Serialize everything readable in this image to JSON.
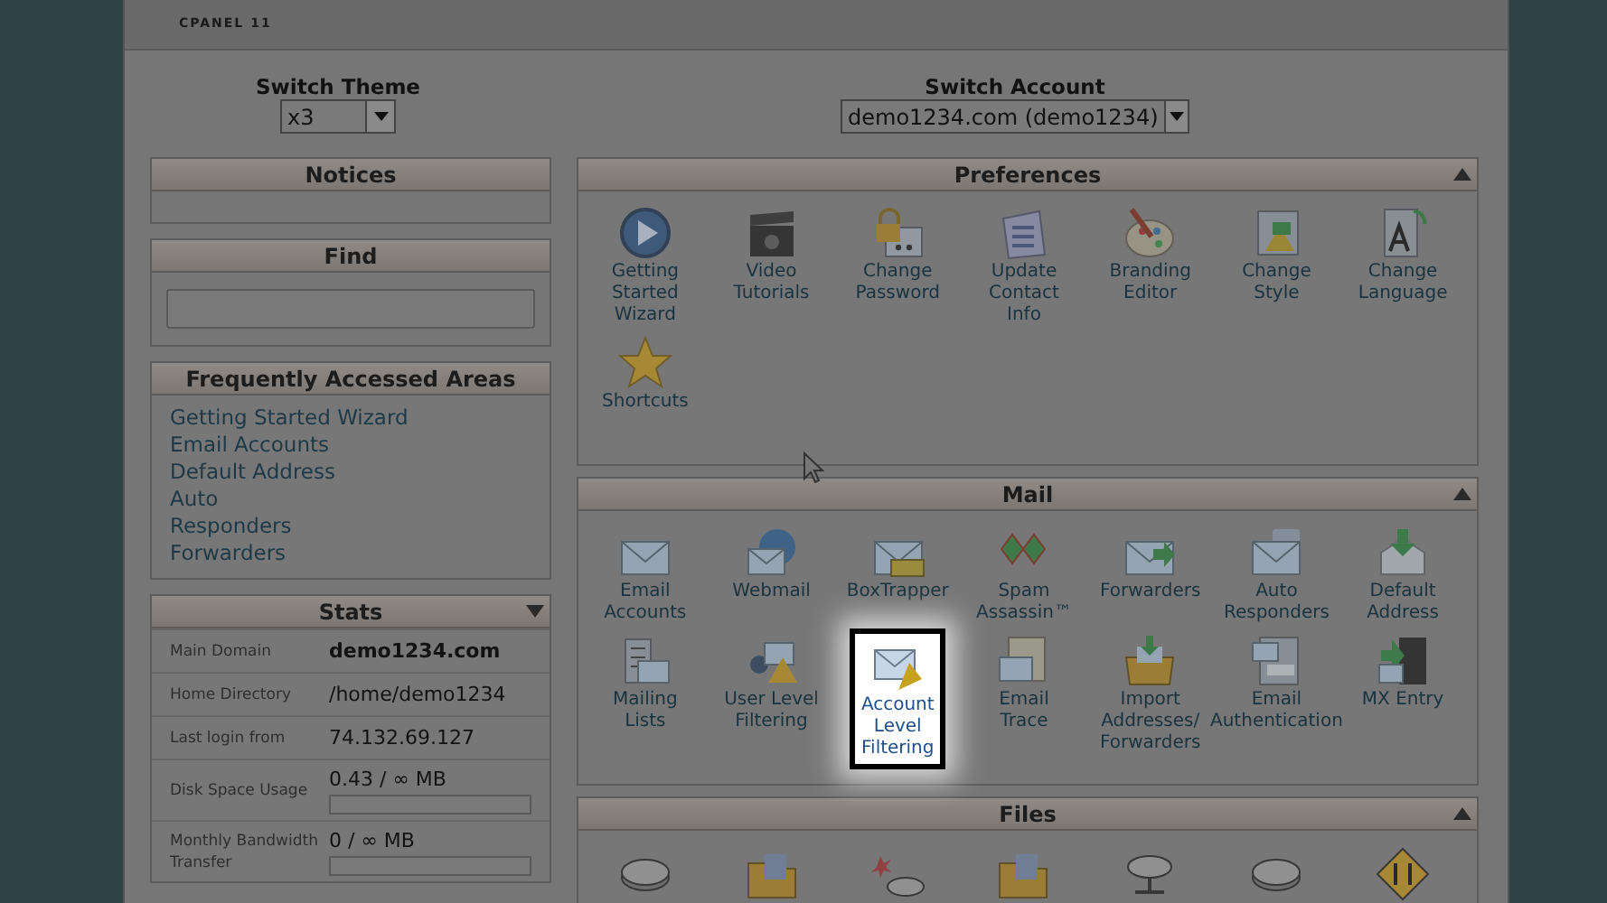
{
  "header": {
    "brand": "CPANEL 11"
  },
  "switch_theme": {
    "label": "Switch Theme",
    "value": "x3"
  },
  "switch_account": {
    "label": "Switch Account",
    "value": "demo1234.com (demo1234)"
  },
  "notices": {
    "title": "Notices"
  },
  "find": {
    "title": "Find"
  },
  "frequently_accessed": {
    "title": "Frequently Accessed Areas",
    "links": [
      "Getting Started Wizard",
      "Email Accounts",
      "Default Address",
      "Auto",
      "Responders",
      "Forwarders"
    ]
  },
  "stats": {
    "title": "Stats",
    "rows": [
      {
        "kind": "text",
        "label": "Main Domain",
        "value": "demo1234.com",
        "bold": true
      },
      {
        "kind": "text",
        "label": "Home Directory",
        "value": "/home/demo1234",
        "bold": false
      },
      {
        "kind": "text",
        "label": "Last login from",
        "value": "74.132.69.127",
        "bold": false
      },
      {
        "kind": "meter",
        "label": "Disk Space Usage",
        "value": "0.43 / ∞ MB",
        "bold": false
      },
      {
        "kind": "meter",
        "label": "Monthly Bandwidth Transfer",
        "value": "0 / ∞ MB",
        "bold": false
      }
    ]
  },
  "sections": [
    {
      "title": "Preferences",
      "items": [
        {
          "lines": [
            "Getting",
            "Started",
            "Wizard"
          ],
          "highlighted": false
        },
        {
          "lines": [
            "Video",
            "Tutorials"
          ],
          "highlighted": false
        },
        {
          "lines": [
            "Change",
            "Password"
          ],
          "highlighted": false
        },
        {
          "lines": [
            "Update",
            "Contact",
            "Info"
          ],
          "highlighted": false
        },
        {
          "lines": [
            "Branding",
            "Editor"
          ],
          "highlighted": false
        },
        {
          "lines": [
            "Change",
            "Style"
          ],
          "highlighted": false
        },
        {
          "lines": [
            "Change",
            "Language"
          ],
          "highlighted": false
        },
        {
          "lines": [
            "Shortcuts"
          ],
          "highlighted": false
        }
      ]
    },
    {
      "title": "Mail",
      "items": [
        {
          "lines": [
            "Email",
            "Accounts"
          ],
          "highlighted": false
        },
        {
          "lines": [
            "Webmail"
          ],
          "highlighted": false
        },
        {
          "lines": [
            "BoxTrapper"
          ],
          "highlighted": false
        },
        {
          "lines": [
            "Spam",
            "Assassin™"
          ],
          "highlighted": false
        },
        {
          "lines": [
            "Forwarders"
          ],
          "highlighted": false
        },
        {
          "lines": [
            "Auto",
            "Responders"
          ],
          "highlighted": false
        },
        {
          "lines": [
            "Default",
            "Address"
          ],
          "highlighted": false
        },
        {
          "lines": [
            "Mailing",
            "Lists"
          ],
          "highlighted": false
        },
        {
          "lines": [
            "User Level",
            "Filtering"
          ],
          "highlighted": false
        },
        {
          "lines": [
            "Account",
            "Level",
            "Filtering"
          ],
          "highlighted": true
        },
        {
          "lines": [
            "Email",
            "Trace"
          ],
          "highlighted": false
        },
        {
          "lines": [
            "Import",
            "Addresses/",
            "Forwarders"
          ],
          "highlighted": false
        },
        {
          "lines": [
            "Email",
            "Authentication"
          ],
          "highlighted": false
        },
        {
          "lines": [
            "MX Entry"
          ],
          "highlighted": false
        }
      ]
    },
    {
      "title": "Files"
    }
  ]
}
